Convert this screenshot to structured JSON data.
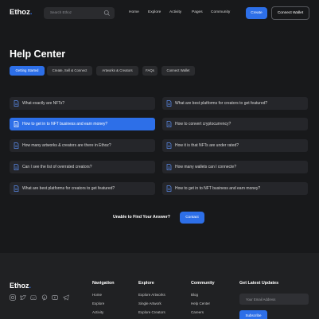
{
  "header": {
    "logo_main": "Ethoz",
    "logo_accent": ".",
    "search_placeholder": "Search Ethoz",
    "nav": [
      "Home",
      "Explore",
      "Activity",
      "Pages",
      "Community"
    ],
    "create_label": "Create",
    "connect_label": "Connect Wallet"
  },
  "page": {
    "title": "Help Center",
    "tabs": [
      "Getting Started",
      "Create, Sell & Connect",
      "Artworks & Creators",
      "FAQs",
      "Connect Wallet"
    ],
    "active_tab": "Getting Started"
  },
  "faqs": {
    "left": [
      "What exactly are NFTs?",
      "How to get in to NFT business and earn money?",
      "How many artworks & creators are there in Ethoz?",
      "Can I see the list of overrated creators?",
      "What are best platforms for creators to get featured?"
    ],
    "right": [
      "What are best platforms for creators to get featured?",
      "How to convert cryptocurrency?",
      "How it is that NFTs are under rated?",
      "How many wallets can I connecte?",
      "How to get in to NFT business and earn money?"
    ]
  },
  "contact": {
    "prompt": "Unable to Find Your Answer?",
    "button": "Contact"
  },
  "footer": {
    "logo_main": "Ethoz",
    "logo_accent": ".",
    "columns": [
      {
        "title": "Navigation",
        "links": [
          "Home",
          "Explore",
          "Activity"
        ]
      },
      {
        "title": "Explore",
        "links": [
          "Explore Artworks",
          "Single Artwork",
          "Explore Creators"
        ]
      },
      {
        "title": "Community",
        "links": [
          "Blog",
          "Help Center",
          "Careers"
        ]
      }
    ],
    "updates_title": "Get Latest Updates",
    "email_placeholder": "Your Email Address",
    "subscribe_label": "Subscribe",
    "social_icons": [
      "instagram-icon",
      "twitter-icon",
      "discord-icon",
      "pinterest-icon",
      "youtube-icon",
      "telegram-icon"
    ]
  },
  "colors": {
    "accent": "#2d6fe8",
    "background": "#18191b",
    "card": "#25262a",
    "footer": "#202123"
  }
}
